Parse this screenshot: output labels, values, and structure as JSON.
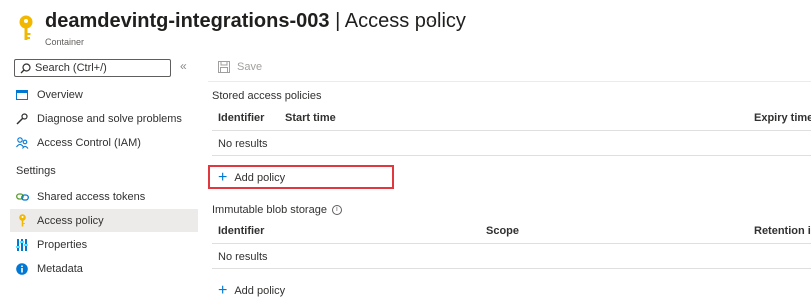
{
  "header": {
    "resource_name": "deamdevintg-integrations-003",
    "separator": " | ",
    "blade_title": "Access policy",
    "more_label": "···",
    "subtitle": "Container"
  },
  "sidebar": {
    "search_placeholder": "Search (Ctrl+/)",
    "collapse_label": "«",
    "items": [
      {
        "label": "Overview",
        "icon": "overview-icon"
      },
      {
        "label": "Diagnose and solve problems",
        "icon": "wrench-icon"
      },
      {
        "label": "Access Control (IAM)",
        "icon": "people-icon"
      }
    ],
    "settings_label": "Settings",
    "settings_items": [
      {
        "label": "Shared access tokens",
        "icon": "link-icon"
      },
      {
        "label": "Access policy",
        "icon": "key-icon",
        "active": true
      },
      {
        "label": "Properties",
        "icon": "properties-icon"
      },
      {
        "label": "Metadata",
        "icon": "info-icon"
      }
    ]
  },
  "toolbar": {
    "save_label": "Save"
  },
  "stored_policies": {
    "label": "Stored access policies",
    "columns": [
      "Identifier",
      "Start time",
      "Expiry time"
    ],
    "empty_text": "No results",
    "add_label": "Add policy"
  },
  "immutable_storage": {
    "label": "Immutable blob storage",
    "columns": [
      "Identifier",
      "Scope",
      "Retention i"
    ],
    "empty_text": "No results",
    "add_label": "Add policy"
  },
  "colors": {
    "accent": "#0078d4",
    "highlight": "#e0383e",
    "key_gold": "#f2b800",
    "active_bg": "#edebe9"
  }
}
